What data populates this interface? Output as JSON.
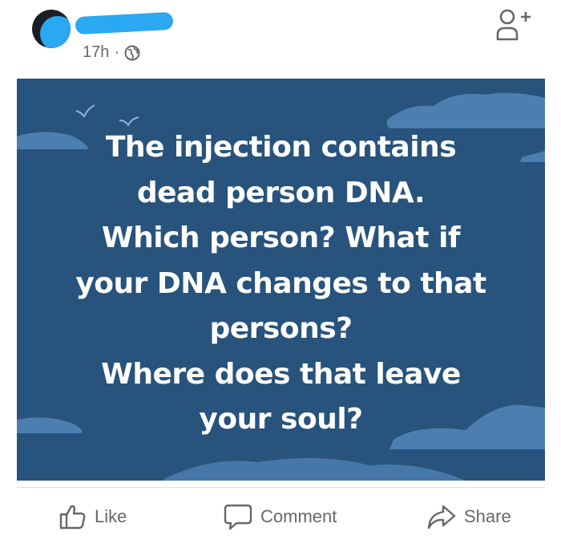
{
  "post": {
    "time": "17h",
    "separator": "·",
    "lines": [
      "The injection contains",
      "dead person DNA.",
      "Which person? What if",
      "your DNA changes to that",
      "persons?",
      "Where does that leave",
      "your soul?"
    ]
  },
  "actions": {
    "like": "Like",
    "comment": "Comment",
    "share": "Share"
  },
  "colors": {
    "banner": "#27537d",
    "cloud": "#4d7eb0",
    "redaction": "#2aa8f2",
    "muted_text": "#65676b"
  },
  "icons": [
    "globe-icon",
    "add-friend-icon",
    "like-icon",
    "comment-icon",
    "share-icon",
    "bird-icon"
  ]
}
